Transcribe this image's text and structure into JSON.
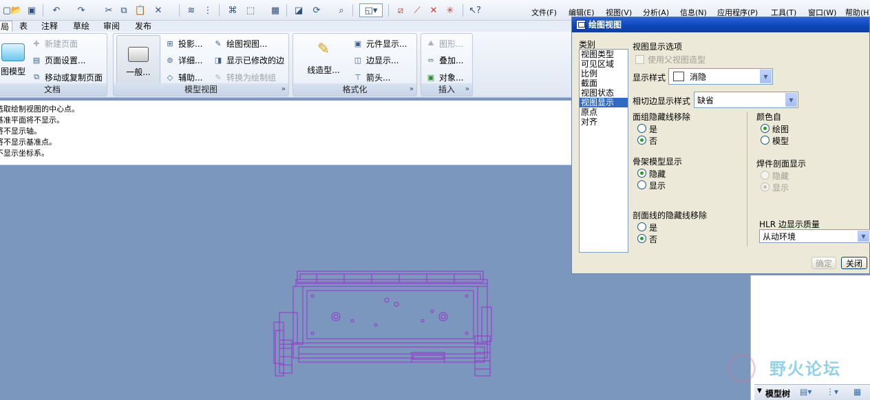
{
  "menu": {
    "file": "文件(F)",
    "edit": "编辑(E)",
    "view": "视图(V)",
    "analysis": "分析(A)",
    "info": "信息(N)",
    "apps": "应用程序(P)",
    "tools": "工具(T)",
    "window": "窗口(W)",
    "help": "帮助(H)"
  },
  "tabs": {
    "layout": "局",
    "table": "表",
    "annotate": "注释",
    "sketch": "草绘",
    "review": "审阅",
    "publish": "发布"
  },
  "ribbon": {
    "doc": {
      "title": "文档",
      "drawing_model": "图模型",
      "new_page": "新建页面",
      "page_setup": "页面设置...",
      "move_copy_page": "移动或复制页面"
    },
    "model_views": {
      "title": "模型视图",
      "general": "一般...",
      "projection": "投影...",
      "detail": "详细...",
      "auxiliary": "辅助...",
      "drawing_view": "绘图视图...",
      "show_modified_edges": "显示已修改的边",
      "convert_to_draft": "转换为绘制组"
    },
    "format": {
      "title": "格式化",
      "line_style": "线造型...",
      "element_display": "元件显示...",
      "edge_display": "边显示...",
      "arrows": "箭头..."
    },
    "insert": {
      "title": "插入",
      "graphics": "图形...",
      "overlay": "叠加...",
      "object": "对象..."
    }
  },
  "messages": [
    "选取绘制视图的中心点。",
    "基准平面将不显示。",
    "将不显示轴。",
    "将不显示基准点。",
    "不显示坐标系。"
  ],
  "dialog": {
    "title": "绘图视图",
    "category_label": "类别",
    "categories": [
      "视图类型",
      "可见区域",
      "比例",
      "截面",
      "视图状态",
      "视图显示",
      "原点",
      "对齐"
    ],
    "selected_category": "视图显示",
    "section_title": "视图显示选项",
    "use_parent_style": "使用父视图造型",
    "display_style_label": "显示样式",
    "display_style_value": "消隐",
    "tangent_edge_label": "相切边显示样式",
    "tangent_edge_value": "缺省",
    "face_hidden_label": "面组隐藏线移除",
    "yes": "是",
    "no": "否",
    "color_from_label": "颜色自",
    "color_drawing": "绘图",
    "color_model": "模型",
    "skeleton_label": "骨架模型显示",
    "hide": "隐藏",
    "show": "显示",
    "weld_label": "焊件剖面显示",
    "weld_hide": "隐藏",
    "weld_show": "显示",
    "section_hidden_label": "剖面线的隐藏线移除",
    "hlr_label": "HLR 边显示质量",
    "hlr_value": "从动环境",
    "ok": "确定",
    "close": "关闭"
  },
  "side": {
    "model_tree": "模型树",
    "watermark": "野火论坛"
  },
  "colors": {
    "wireframe": "#9b2fd0",
    "graphics_bg": "#7b97bd",
    "dialog_title": "#0a45b8"
  }
}
